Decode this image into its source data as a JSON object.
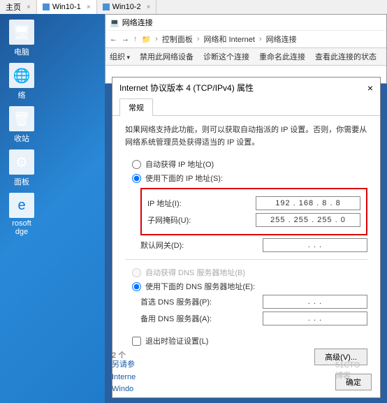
{
  "tabs": {
    "home": "主页",
    "vm1": "Win10-1",
    "vm2": "Win10-2"
  },
  "desktop": {
    "computer": "电脑",
    "network": "络",
    "recycle": "收站",
    "panel": "面板",
    "edge1": "rosoft",
    "edge2": "dge"
  },
  "explorer": {
    "title": "网络连接",
    "bread": {
      "cp": "控制面板",
      "net": "网络和 Internet",
      "conn": "网络连接"
    },
    "tools": {
      "org": "组织",
      "disable": "禁用此网络设备",
      "diag": "诊断这个连接",
      "rename": "重命名此连接",
      "status": "查看此连接的状态"
    }
  },
  "dialog": {
    "title": "Internet 协议版本 4 (TCP/IPv4) 属性",
    "tab_general": "常规",
    "desc": "如果网络支持此功能，则可以获取自动指派的 IP 设置。否则，你需要从网络系统管理员处获得适当的 IP 设置。",
    "auto_ip": "自动获得 IP 地址(O)",
    "manual_ip": "使用下面的 IP 地址(S):",
    "ip_label": "IP 地址(I):",
    "ip_value": "192 . 168 .  8  .  8",
    "mask_label": "子网掩码(U):",
    "mask_value": "255 . 255 . 255 .  0",
    "gw_label": "默认网关(D):",
    "gw_value": ".       .       .",
    "auto_dns": "自动获得 DNS 服务器地址(B)",
    "manual_dns": "使用下面的 DNS 服务器地址(E):",
    "dns1_label": "首选 DNS 服务器(P):",
    "dns1_value": ".       .       .",
    "dns2_label": "备用 DNS 服务器(A):",
    "dns2_value": ".       .       .",
    "validate": "退出时验证设置(L)",
    "advanced": "高级(V)...",
    "ok": "确定",
    "cancel": "51CTO博客"
  },
  "misc": {
    "count": "2 个",
    "extra": "另请参",
    "internet": "Interne",
    "windows": "Windo"
  }
}
